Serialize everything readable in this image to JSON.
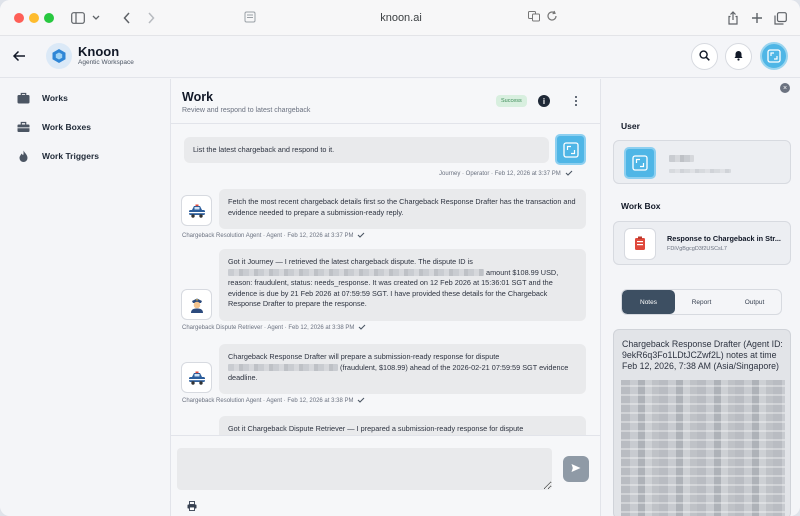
{
  "browser": {
    "url": "knoon.ai"
  },
  "app": {
    "name": "Knoon",
    "tagline": "Agentic Workspace"
  },
  "sidebar": {
    "items": [
      {
        "label": "Works",
        "icon": "bag-icon"
      },
      {
        "label": "Work Boxes",
        "icon": "toolbox-icon"
      },
      {
        "label": "Work Triggers",
        "icon": "flame-icon"
      }
    ]
  },
  "work": {
    "title": "Work",
    "subtitle": "Review and respond to latest chargeback",
    "status": "Success"
  },
  "messages": [
    {
      "role": "user",
      "text": "List the latest chargeback and respond to it.",
      "meta": "Journey · Operator · Feb 12, 2026 at 3:37 PM"
    },
    {
      "role": "agent",
      "text": "Fetch the most recent chargeback details first so the Chargeback Response Drafter has the transaction and evidence needed to prepare a submission-ready reply.",
      "meta": "Chargeback Resolution Agent · Agent · Feb 12, 2026 at 3:37 PM"
    },
    {
      "role": "agent",
      "text_a": "Got it Journey — I retrieved the latest chargeback dispute. The dispute ID is",
      "text_b": "amount $108.99 USD, reason: fraudulent, status: needs_response. It was created on 12 Feb 2026 at 15:36:01 SGT and the evidence is due by 21 Feb 2026 at 07:59:59 SGT. I have provided these details for the Chargeback Response Drafter to prepare the response.",
      "meta": "Chargeback Dispute Retriever · Agent · Feb 12, 2026 at 3:38 PM"
    },
    {
      "role": "agent",
      "text_a": "Chargeback Response Drafter will prepare a submission-ready response for dispute",
      "text_b": "(fraudulent, $108.99) ahead of the 2026-02-21 07:59:59 SGT evidence deadline.",
      "meta": "Chargeback Resolution Agent · Agent · Feb 12, 2026 at 3:38 PM"
    },
    {
      "role": "agent",
      "text": "Got it Chargeback Dispute Retriever — I prepared a submission-ready response for dispute"
    }
  ],
  "right_panel": {
    "user_section": "User",
    "workbox_section": "Work Box",
    "workbox_title": "Response to Chargeback in Str...",
    "workbox_id": "FDiVgBgcgD3f2USCsL7",
    "tabs": [
      "Notes",
      "Report",
      "Output"
    ],
    "active_tab": "Notes",
    "notes_heading": "Chargeback Response Drafter (Agent ID: 9ekR6q3Fo1LDtJCZwf2L) notes at time Feb 12, 2026, 7:38 AM (Asia/Singapore)"
  }
}
